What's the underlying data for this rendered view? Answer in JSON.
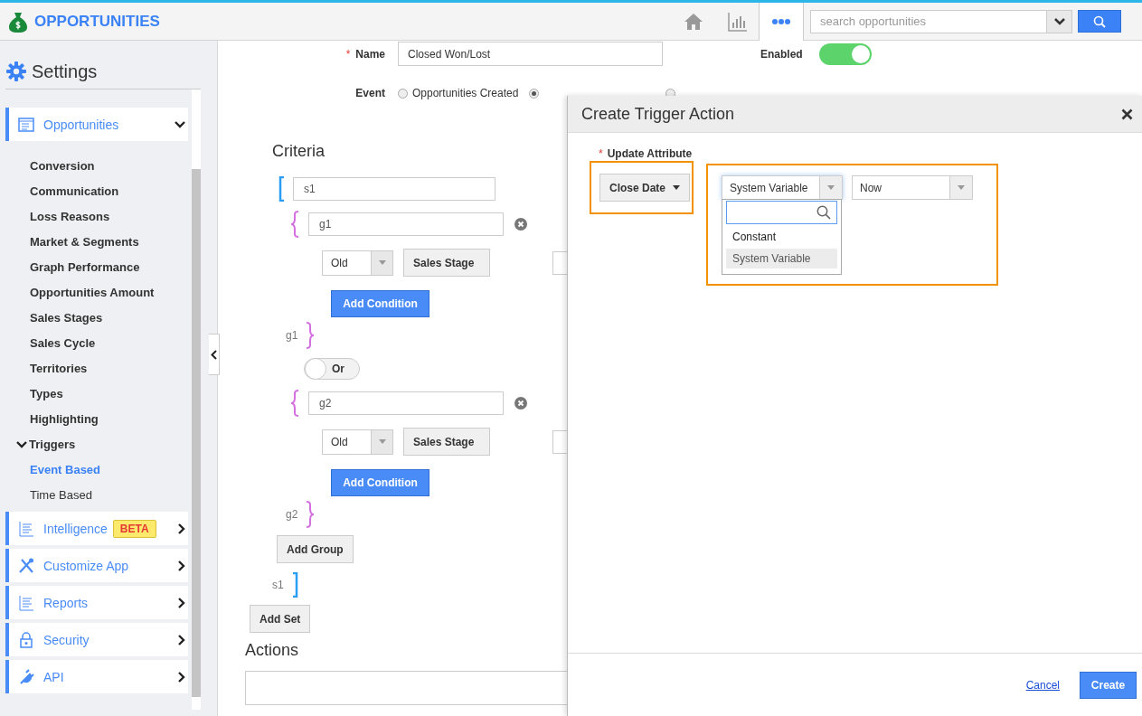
{
  "app": {
    "title": "OPPORTUNITIES"
  },
  "nav": {
    "icons": [
      {
        "kind": "home",
        "selected": false
      },
      {
        "kind": "chart",
        "selected": false
      },
      {
        "kind": "more",
        "selected": true
      }
    ],
    "search": {
      "placeholder": "search opportunities"
    }
  },
  "sidebar": {
    "title": "Settings",
    "items": [
      {
        "label": "Opportunities",
        "kind": "form",
        "expanded": true,
        "children": [
          {
            "label": "Conversion",
            "selected": false
          },
          {
            "label": "Communication",
            "selected": false
          },
          {
            "label": "Loss Reasons",
            "selected": false
          },
          {
            "label": "Market & Segments",
            "selected": false
          },
          {
            "label": "Graph Performance",
            "selected": false
          },
          {
            "label": "Opportunities Amount",
            "selected": false
          },
          {
            "label": "Sales Stages",
            "selected": false
          },
          {
            "label": "Sales Cycle",
            "selected": false
          },
          {
            "label": "Territories",
            "selected": false
          },
          {
            "label": "Types",
            "selected": false
          },
          {
            "label": "Highlighting",
            "selected": false
          },
          {
            "label": "Triggers",
            "selected": false,
            "expanded": true,
            "children": [
              {
                "label": "Event Based",
                "selected": true
              },
              {
                "label": "Time Based",
                "selected": false
              }
            ]
          }
        ]
      },
      {
        "label": "Intelligence",
        "kind": "lines",
        "expanded": false,
        "badge": "BETA"
      },
      {
        "label": "Customize App",
        "kind": "tools",
        "expanded": false
      },
      {
        "label": "Reports",
        "kind": "lines",
        "expanded": false
      },
      {
        "label": "Security",
        "kind": "lock",
        "expanded": false
      },
      {
        "label": "API",
        "kind": "plug",
        "expanded": false
      }
    ]
  },
  "form": {
    "name": {
      "label": "Name",
      "required_mark": "*",
      "value": "Closed Won/Lost"
    },
    "enabled": {
      "label": "Enabled",
      "on": true
    },
    "event": {
      "label": "Event",
      "options": [
        {
          "label": "Opportunities Created",
          "selected": false
        },
        {
          "selected": true
        },
        {
          "selected": false
        }
      ]
    },
    "criteria": {
      "title": "Criteria",
      "set": {
        "name": "s1",
        "close_label": "s1",
        "groups": [
          {
            "name": "g1",
            "close_label": "g1",
            "conditions": [
              {
                "mode": "Old",
                "attribute": "Sales Stage"
              }
            ],
            "add_button": "Add Condition"
          },
          {
            "join": {
              "label": "Or",
              "on": false
            },
            "name": "g2",
            "close_label": "g2",
            "conditions": [
              {
                "mode": "Old",
                "attribute": "Sales Stage"
              }
            ],
            "add_button": "Add Condition"
          }
        ],
        "add_group": "Add Group"
      },
      "add_set": "Add Set"
    },
    "actions": {
      "title": "Actions"
    }
  },
  "modal": {
    "title": "Create Trigger Action",
    "field_label": "Update Attribute",
    "required_mark": "*",
    "attribute": "Close Date",
    "type_select": "System Variable",
    "value_select": "Now",
    "dropdown": {
      "options": [
        {
          "label": "Constant",
          "selected": false
        },
        {
          "label": "System Variable",
          "selected": true
        }
      ]
    },
    "cancel": "Cancel",
    "create": "Create"
  }
}
